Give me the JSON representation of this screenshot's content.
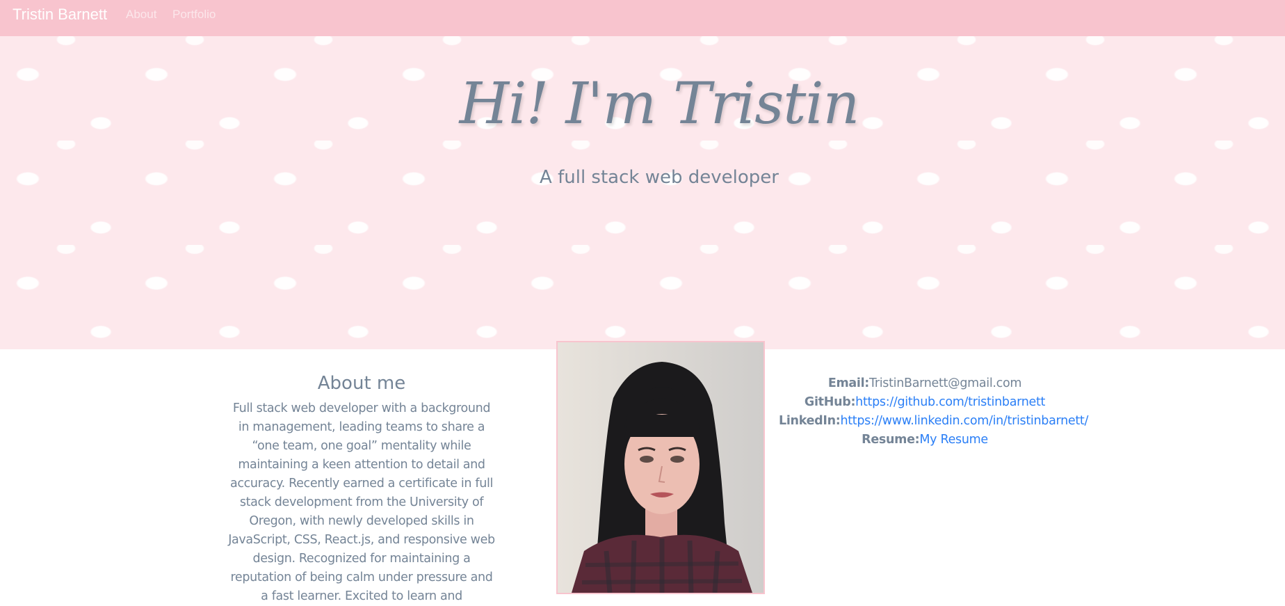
{
  "navbar": {
    "brand": "Tristin Barnett",
    "links": [
      "About",
      "Portfolio"
    ]
  },
  "hero": {
    "title": "Hi! I'm Tristin",
    "subtitle": "A full stack web developer"
  },
  "about": {
    "heading": "About me",
    "body": "Full stack web developer with a background in management, leading teams to share a “one team, one goal” mentality while maintaining a keen attention to detail and accuracy. Recently earned a certificate in full stack development from the University of Oregon, with newly developed skills in JavaScript, CSS, React.js, and responsive web design. Recognized for maintaining a reputation of being calm under pressure and a fast learner. Excited to learn and"
  },
  "contact": {
    "email": {
      "label": "Email:",
      "value": "TristinBarnett@gmail.com"
    },
    "github": {
      "label": "GitHub:",
      "value": "https://github.com/tristinbarnett"
    },
    "linkedin": {
      "label": "LinkedIn:",
      "value": "https://www.linkedin.com/in/tristinbarnett/"
    },
    "resume": {
      "label": "Resume:",
      "value": "My Resume"
    }
  },
  "colors": {
    "navbar": "#f8c4ce",
    "hero_bg": "#fde8ec",
    "text": "#748496",
    "link": "#2b7ff6"
  },
  "icons": {
    "hero_pattern": "cloud-icon",
    "profile_photo": "portrait-photo"
  }
}
